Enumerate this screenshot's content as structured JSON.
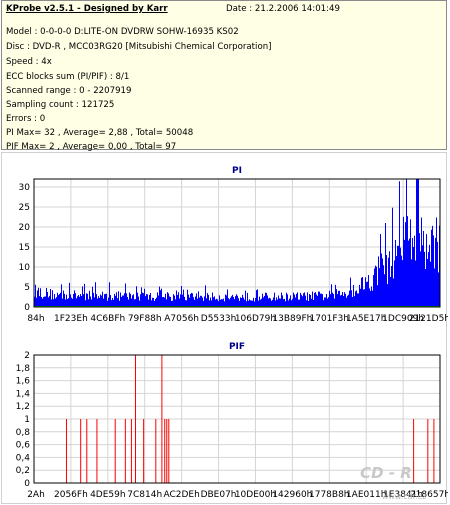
{
  "info": {
    "app_title": "KProbe v2.5.1 - Designed by Karr",
    "date": "Date : 21.2.2006 14:01:49",
    "lines": [
      "Model : 0-0-0-0 D:LITE-ON DVDRW SOHW-16935 KS02",
      "Disc : DVD-R , MCC03RG20 [Mitsubishi Chemical Corporation]",
      "Speed : 4x",
      "ECC blocks sum (PI/PIF) : 8/1",
      "Scanned range : 0 - 2207919",
      "Sampling count : 121725",
      "Errors : 0",
      "PI Max= 32 , Average= 2,88 , Total= 50048",
      "PIF Max= 2 , Average= 0,00 , Total= 97"
    ]
  },
  "colors": {
    "info_bg": "#ffffe6",
    "pi_series": "#0000ff",
    "pif_series": "#ff0000",
    "title": "#00008b",
    "grid": "#d4d4d4"
  },
  "watermark": {
    "text": "CD - R",
    "url": "www.cdr.cz"
  },
  "chart_data": [
    {
      "type": "bar",
      "title": "PI",
      "xlabel": "",
      "ylabel": "",
      "ylim": [
        0,
        32
      ],
      "yticks": [
        0,
        5,
        10,
        15,
        20,
        25,
        30
      ],
      "xlim": [
        0,
        2207919
      ],
      "x_tick_labels": [
        "84h",
        "1F23Eh",
        "4C6BFh",
        "79F88h",
        "A7056h",
        "D5533h",
        "106D79h",
        "13B89Fh",
        "1701F3h",
        "1A5E17h",
        "1DC909h",
        "2121D5h"
      ],
      "grid": true,
      "series": [
        {
          "name": "PI",
          "profile_x": [
            0,
            0.05,
            0.15,
            0.3,
            0.45,
            0.55,
            0.65,
            0.72,
            0.75,
            0.79,
            0.82,
            0.86,
            0.89,
            0.91,
            0.93,
            0.95,
            1.0
          ],
          "profile_mean": [
            4,
            3,
            2.8,
            2.6,
            2.5,
            2.5,
            2.6,
            2.8,
            3.2,
            4.5,
            6.5,
            9,
            13,
            16,
            20,
            18,
            15
          ],
          "max": 32
        }
      ]
    },
    {
      "type": "bar",
      "title": "PIF",
      "xlabel": "",
      "ylabel": "",
      "ylim": [
        0,
        2
      ],
      "yticks": [
        0,
        0.2,
        0.4,
        0.6,
        0.8,
        1,
        1.2,
        1.4,
        1.6,
        1.8,
        2
      ],
      "ytick_labels": [
        "0",
        "0,2",
        "0,4",
        "0,6",
        "0,8",
        "1",
        "1,2",
        "1,4",
        "1,6",
        "1,8",
        "2"
      ],
      "xlim": [
        0,
        2207919
      ],
      "x_tick_labels": [
        "2Ah",
        "2056Fh",
        "4DE59h",
        "7C814h",
        "AC2DEh",
        "DBE07h",
        "10DE00h",
        "142960h",
        "1778B8h",
        "1AE011h",
        "1E3841h",
        "218657h"
      ],
      "grid": true,
      "series": [
        {
          "name": "PIF",
          "spikes": [
            {
              "x": 0.08,
              "y": 1
            },
            {
              "x": 0.115,
              "y": 1
            },
            {
              "x": 0.13,
              "y": 1
            },
            {
              "x": 0.155,
              "y": 1
            },
            {
              "x": 0.2,
              "y": 1
            },
            {
              "x": 0.225,
              "y": 1
            },
            {
              "x": 0.24,
              "y": 1
            },
            {
              "x": 0.25,
              "y": 2
            },
            {
              "x": 0.27,
              "y": 1
            },
            {
              "x": 0.3,
              "y": 1
            },
            {
              "x": 0.315,
              "y": 2
            },
            {
              "x": 0.322,
              "y": 1
            },
            {
              "x": 0.327,
              "y": 1
            },
            {
              "x": 0.332,
              "y": 1
            },
            {
              "x": 0.935,
              "y": 1
            },
            {
              "x": 0.97,
              "y": 1
            },
            {
              "x": 0.985,
              "y": 1
            }
          ]
        }
      ]
    }
  ]
}
